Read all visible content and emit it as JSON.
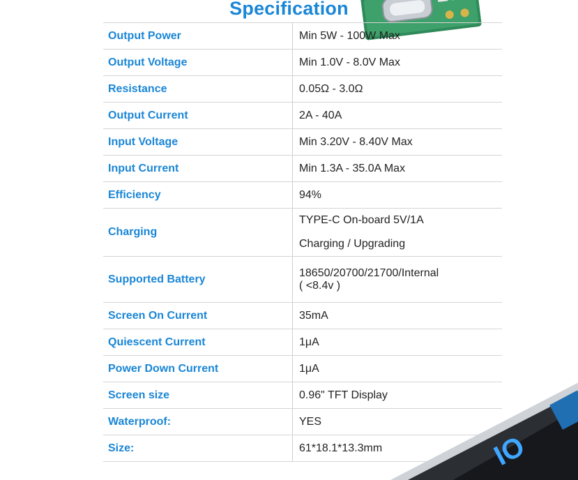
{
  "title": "Specification",
  "accent_color": "#1a86d6",
  "rows": [
    {
      "label": "Output Power",
      "value": "Min 5W - 100W Max"
    },
    {
      "label": "Output Voltage",
      "value": "Min 1.0V - 8.0V Max"
    },
    {
      "label": "Resistance",
      "value": "0.05Ω - 3.0Ω"
    },
    {
      "label": "Output Current",
      "value": "2A - 40A"
    },
    {
      "label": "Input Voltage",
      "value": "Min 3.20V - 8.40V Max"
    },
    {
      "label": "Input Current",
      "value": "Min 1.3A - 35.0A Max"
    },
    {
      "label": "Efficiency",
      "value": "94%"
    },
    {
      "label": "Charging",
      "value_lines": [
        "TYPE-C On-board 5V/1A",
        "Charging / Upgrading"
      ]
    },
    {
      "label": "Supported Battery",
      "value_lines": [
        "18650/20700/21700/Internal",
        "( <8.4v )"
      ]
    },
    {
      "label": "Screen On Current",
      "value": "35mA"
    },
    {
      "label": "Quiescent Current",
      "value": "1μA"
    },
    {
      "label": "Power Down Current",
      "value": "1μA"
    },
    {
      "label": "Screen size",
      "value": "0.96\" TFT Display"
    },
    {
      "label": "Waterproof:",
      "value": "YES"
    },
    {
      "label": "Size:",
      "value": "61*18.1*13.3mm"
    }
  ]
}
